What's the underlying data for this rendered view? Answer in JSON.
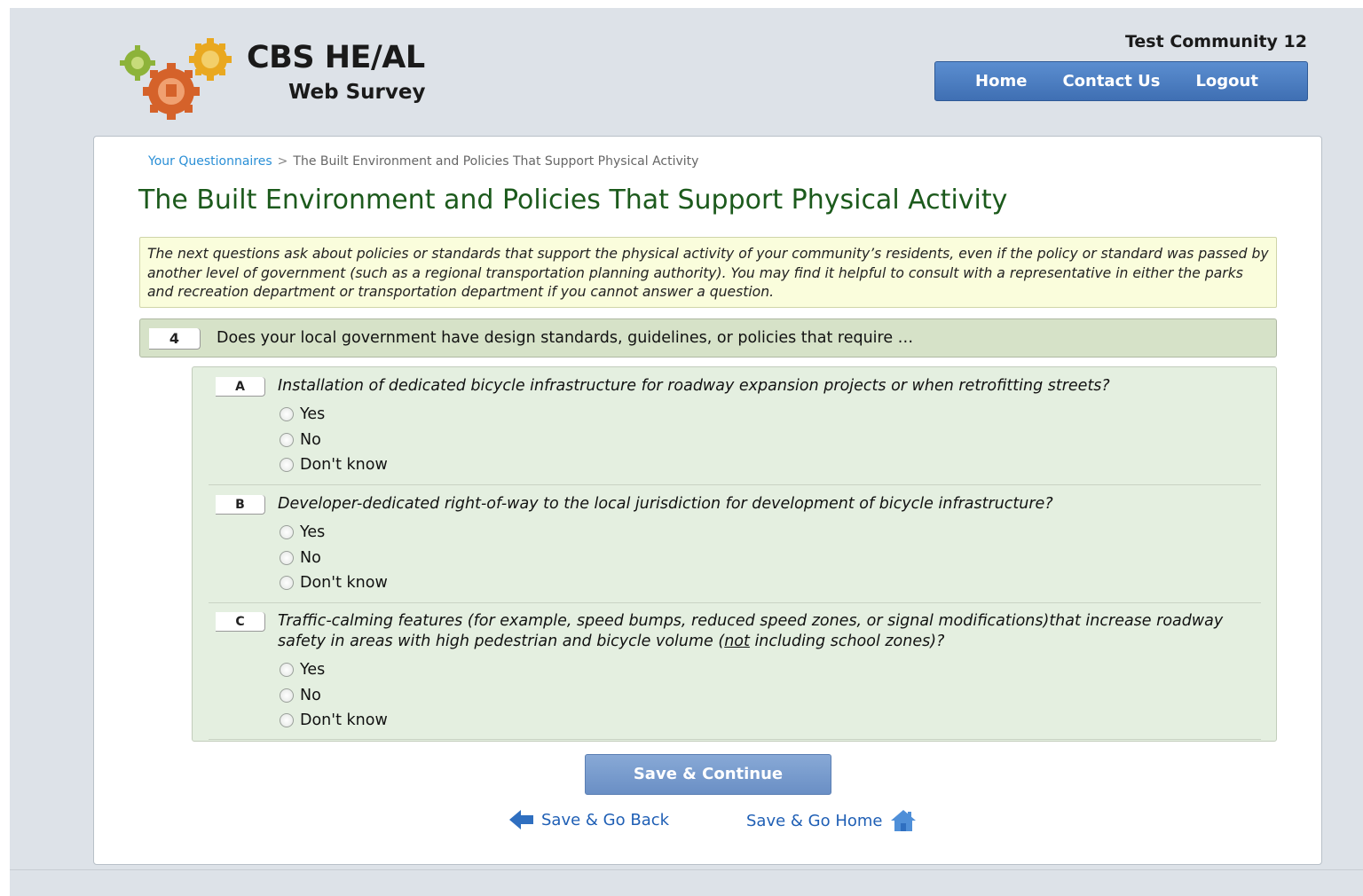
{
  "header": {
    "app_title": "CBS HE/AL",
    "app_subtitle": "Web Survey",
    "community": "Test Community 12",
    "nav": {
      "home": "Home",
      "contact": "Contact Us",
      "logout": "Logout"
    },
    "brand_color": "#4a7cc0"
  },
  "breadcrumb": {
    "root": "Your Questionnaires",
    "separator": ">",
    "current": "The Built Environment and Policies That Support Physical Activity"
  },
  "page_title": "The Built Environment and Policies That Support Physical Activity",
  "intro": "The next questions ask about policies or standards that support the physical activity of your community’s residents, even if the policy or standard was passed by another level of government (such as a regional transportation planning authority). You may find it helpful to consult with a representative in either the parks and recreation department or transportation department if you cannot answer a question.",
  "question": {
    "number": "4",
    "text": "Does your local government have design standards, guidelines, or policies that require …",
    "sub_questions": [
      {
        "letter": "A",
        "text": "Installation of dedicated bicycle infrastructure for roadway expansion projects or when retrofitting streets?",
        "options": [
          "Yes",
          "No",
          "Don't know"
        ]
      },
      {
        "letter": "B",
        "text": "Developer-dedicated right-of-way to the local jurisdiction for development of bicycle infrastructure?",
        "options": [
          "Yes",
          "No",
          "Don't know"
        ]
      },
      {
        "letter": "C",
        "text_before": "Traffic-calming features (for example, speed bumps, reduced speed zones, or signal modifications)that increase roadway safety in areas with high pedestrian and bicycle volume (",
        "text_emphasis": "not",
        "text_after": " including school zones)?",
        "options": [
          "Yes",
          "No",
          "Don't know"
        ]
      }
    ]
  },
  "actions": {
    "save_continue": "Save & Continue",
    "save_back": "Save & Go Back",
    "save_home": "Save & Go Home"
  },
  "icons": {
    "logo": "gears-logo-icon",
    "back": "arrow-left-icon",
    "home": "house-icon"
  }
}
